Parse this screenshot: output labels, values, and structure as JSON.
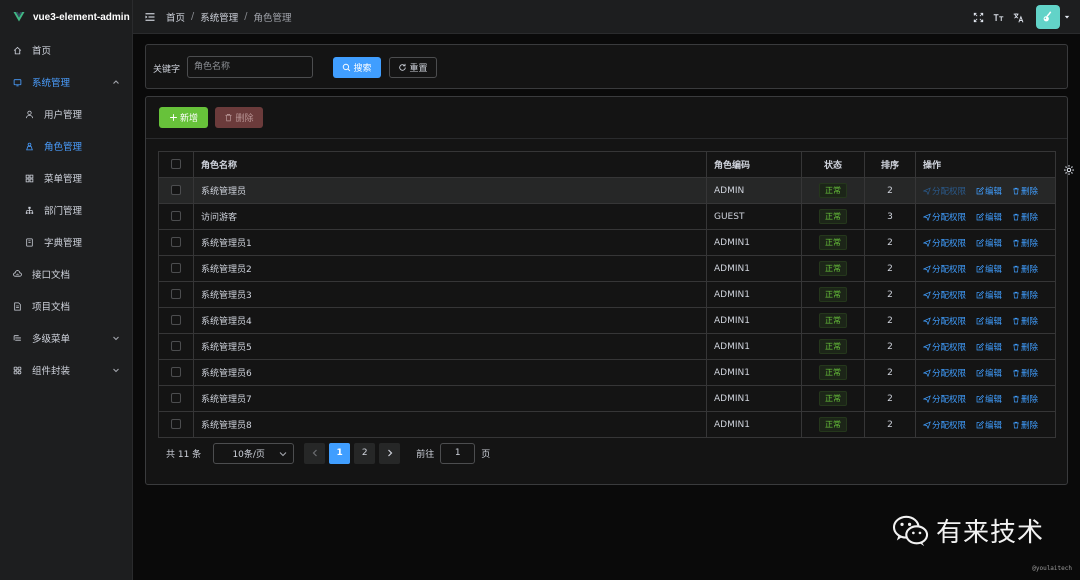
{
  "app": {
    "name": "vue3-element-admin"
  },
  "sidebar": {
    "items": [
      {
        "label": "首页",
        "icon": "home-icon"
      },
      {
        "label": "系统管理",
        "icon": "system-icon",
        "expanded": true
      },
      {
        "label": "用户管理",
        "icon": "user-icon",
        "sub": true
      },
      {
        "label": "角色管理",
        "icon": "role-icon",
        "sub": true,
        "active": true
      },
      {
        "label": "菜单管理",
        "icon": "menu-grid-icon",
        "sub": true
      },
      {
        "label": "部门管理",
        "icon": "tree-icon",
        "sub": true
      },
      {
        "label": "字典管理",
        "icon": "dict-icon",
        "sub": true
      },
      {
        "label": "接口文档",
        "icon": "api-icon"
      },
      {
        "label": "项目文档",
        "icon": "doc-icon"
      },
      {
        "label": "多级菜单",
        "icon": "multi-level-icon",
        "collapsible": true
      },
      {
        "label": "组件封装",
        "icon": "component-icon",
        "collapsible": true
      }
    ]
  },
  "header": {
    "breadcrumb": [
      "首页",
      "系统管理",
      "角色管理"
    ],
    "icons": [
      "fullscreen-icon",
      "font-size-icon",
      "language-icon"
    ]
  },
  "search": {
    "label": "关键字",
    "placeholder": "角色名称",
    "value": "",
    "search_label": "搜索",
    "reset_label": "重置"
  },
  "toolbar": {
    "add_label": "新增",
    "delete_label": "删除"
  },
  "table": {
    "columns": [
      "角色名称",
      "角色编码",
      "状态",
      "排序",
      "操作"
    ],
    "rows": [
      {
        "name": "系统管理员",
        "code": "ADMIN",
        "status": "正常",
        "sort": "2"
      },
      {
        "name": "访问游客",
        "code": "GUEST",
        "status": "正常",
        "sort": "3"
      },
      {
        "name": "系统管理员1",
        "code": "ADMIN1",
        "status": "正常",
        "sort": "2"
      },
      {
        "name": "系统管理员2",
        "code": "ADMIN1",
        "status": "正常",
        "sort": "2"
      },
      {
        "name": "系统管理员3",
        "code": "ADMIN1",
        "status": "正常",
        "sort": "2"
      },
      {
        "name": "系统管理员4",
        "code": "ADMIN1",
        "status": "正常",
        "sort": "2"
      },
      {
        "name": "系统管理员5",
        "code": "ADMIN1",
        "status": "正常",
        "sort": "2"
      },
      {
        "name": "系统管理员6",
        "code": "ADMIN1",
        "status": "正常",
        "sort": "2"
      },
      {
        "name": "系统管理员7",
        "code": "ADMIN1",
        "status": "正常",
        "sort": "2"
      },
      {
        "name": "系统管理员8",
        "code": "ADMIN1",
        "status": "正常",
        "sort": "2"
      }
    ],
    "actions": {
      "assign": "分配权限",
      "edit": "编辑",
      "delete": "删除"
    }
  },
  "pagination": {
    "total": "共 11 条",
    "page_size": "10条/页",
    "pages": [
      "1",
      "2"
    ],
    "current": "1",
    "goto_label": "前往",
    "goto_value": "1",
    "goto_unit": "页"
  },
  "watermark": {
    "text": "有来技术",
    "handle": "@youlaitech"
  },
  "colors": {
    "primary": "#409eff",
    "success": "#67c23a",
    "danger": "#f56c6c",
    "background": "#0a0a0a"
  }
}
